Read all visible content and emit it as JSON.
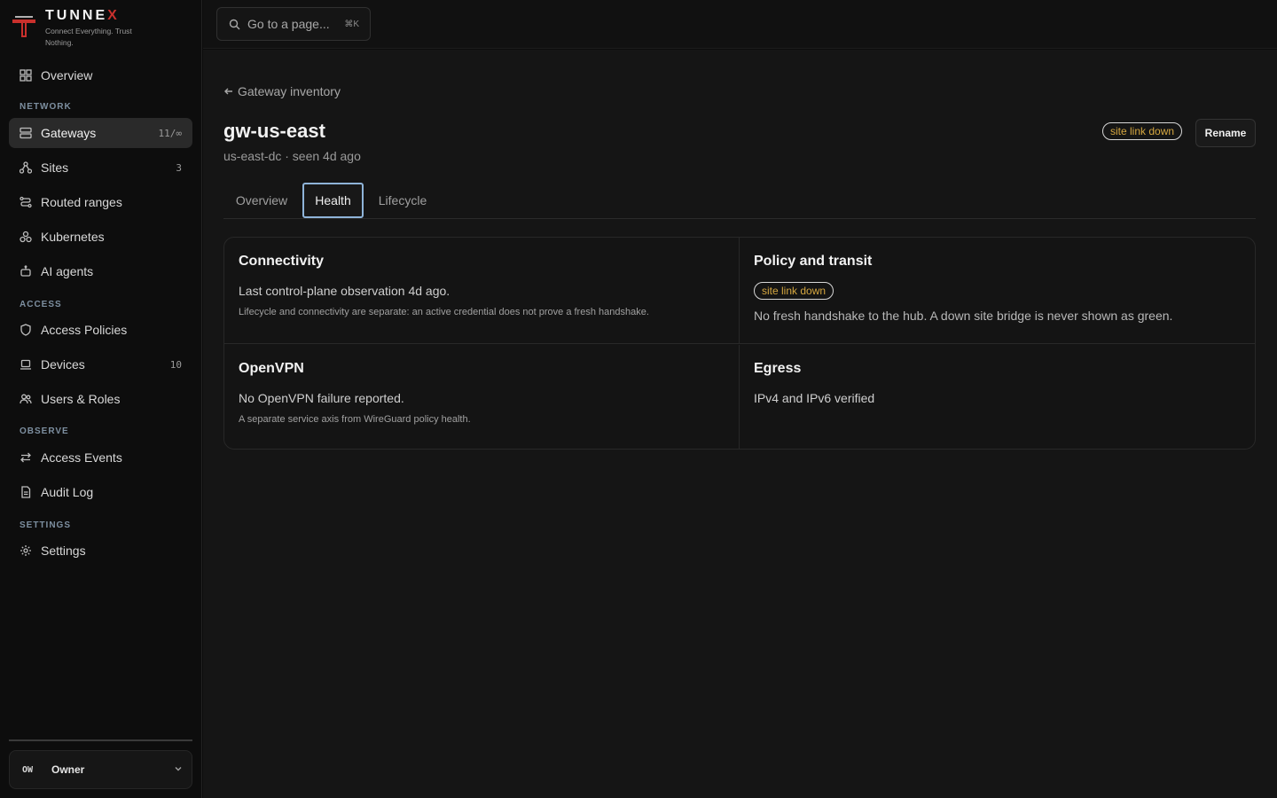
{
  "brand": {
    "name_main": "TUNNE",
    "name_accent": "X",
    "tagline": "Connect Everything. Trust Nothing.",
    "accent_color": "#c9302c"
  },
  "sidebar": {
    "overview": "Overview",
    "sections": {
      "network": "NETWORK",
      "access": "ACCESS",
      "observe": "OBSERVE",
      "settings": "SETTINGS"
    },
    "items": {
      "gateways": {
        "label": "Gateways",
        "count": "11/∞"
      },
      "sites": {
        "label": "Sites",
        "count": "3"
      },
      "routed_ranges": {
        "label": "Routed ranges"
      },
      "kubernetes": {
        "label": "Kubernetes"
      },
      "ai_agents": {
        "label": "AI agents"
      },
      "access_policies": {
        "label": "Access Policies"
      },
      "devices": {
        "label": "Devices",
        "count": "10"
      },
      "users_roles": {
        "label": "Users & Roles"
      },
      "access_events": {
        "label": "Access Events"
      },
      "audit_log": {
        "label": "Audit Log"
      },
      "settings": {
        "label": "Settings"
      }
    },
    "owner": {
      "initials": "OW",
      "name": "Owner"
    }
  },
  "topbar": {
    "search_placeholder": "Go to a page...",
    "shortcut": "⌘K"
  },
  "page": {
    "back_label": "Gateway inventory",
    "title": "gw-us-east",
    "subtitle": "us-east-dc · seen 4d ago",
    "status_badge": "site link down",
    "rename_label": "Rename",
    "tabs": [
      "Overview",
      "Health",
      "Lifecycle"
    ],
    "active_tab": "Health"
  },
  "health": {
    "connectivity": {
      "title": "Connectivity",
      "line": "Last control-plane observation 4d ago.",
      "note": "Lifecycle and connectivity are separate: an active credential does not prove a fresh handshake."
    },
    "policy": {
      "title": "Policy and transit",
      "badge": "site link down",
      "line": "No fresh handshake to the hub. A down site bridge is never shown as green."
    },
    "openvpn": {
      "title": "OpenVPN",
      "line": "No OpenVPN failure reported.",
      "note": "A separate service axis from WireGuard policy health."
    },
    "egress": {
      "title": "Egress",
      "line": "IPv4 and IPv6 verified"
    }
  }
}
